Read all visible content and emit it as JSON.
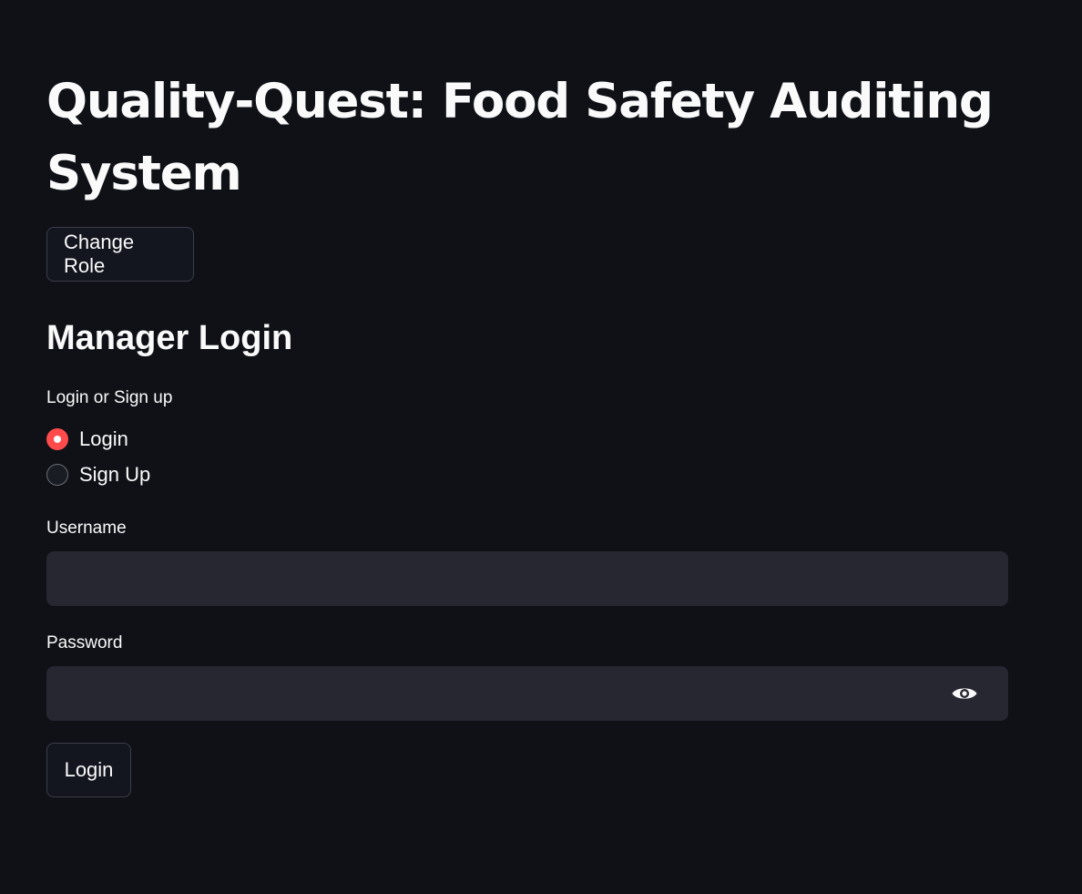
{
  "page": {
    "title": "Quality-Quest: Food Safety Auditing System",
    "change_role_label": "Change Role",
    "section_title": "Manager Login"
  },
  "auth_mode": {
    "label": "Login or Sign up",
    "options": [
      {
        "label": "Login",
        "selected": true
      },
      {
        "label": "Sign Up",
        "selected": false
      }
    ]
  },
  "form": {
    "username_label": "Username",
    "username_value": "",
    "password_label": "Password",
    "password_value": "",
    "password_toggle_icon": "eye-icon",
    "submit_label": "Login"
  },
  "colors": {
    "background": "#0f1117",
    "input_background": "#262730",
    "accent": "#ff4b4b",
    "text": "#fafafa"
  }
}
